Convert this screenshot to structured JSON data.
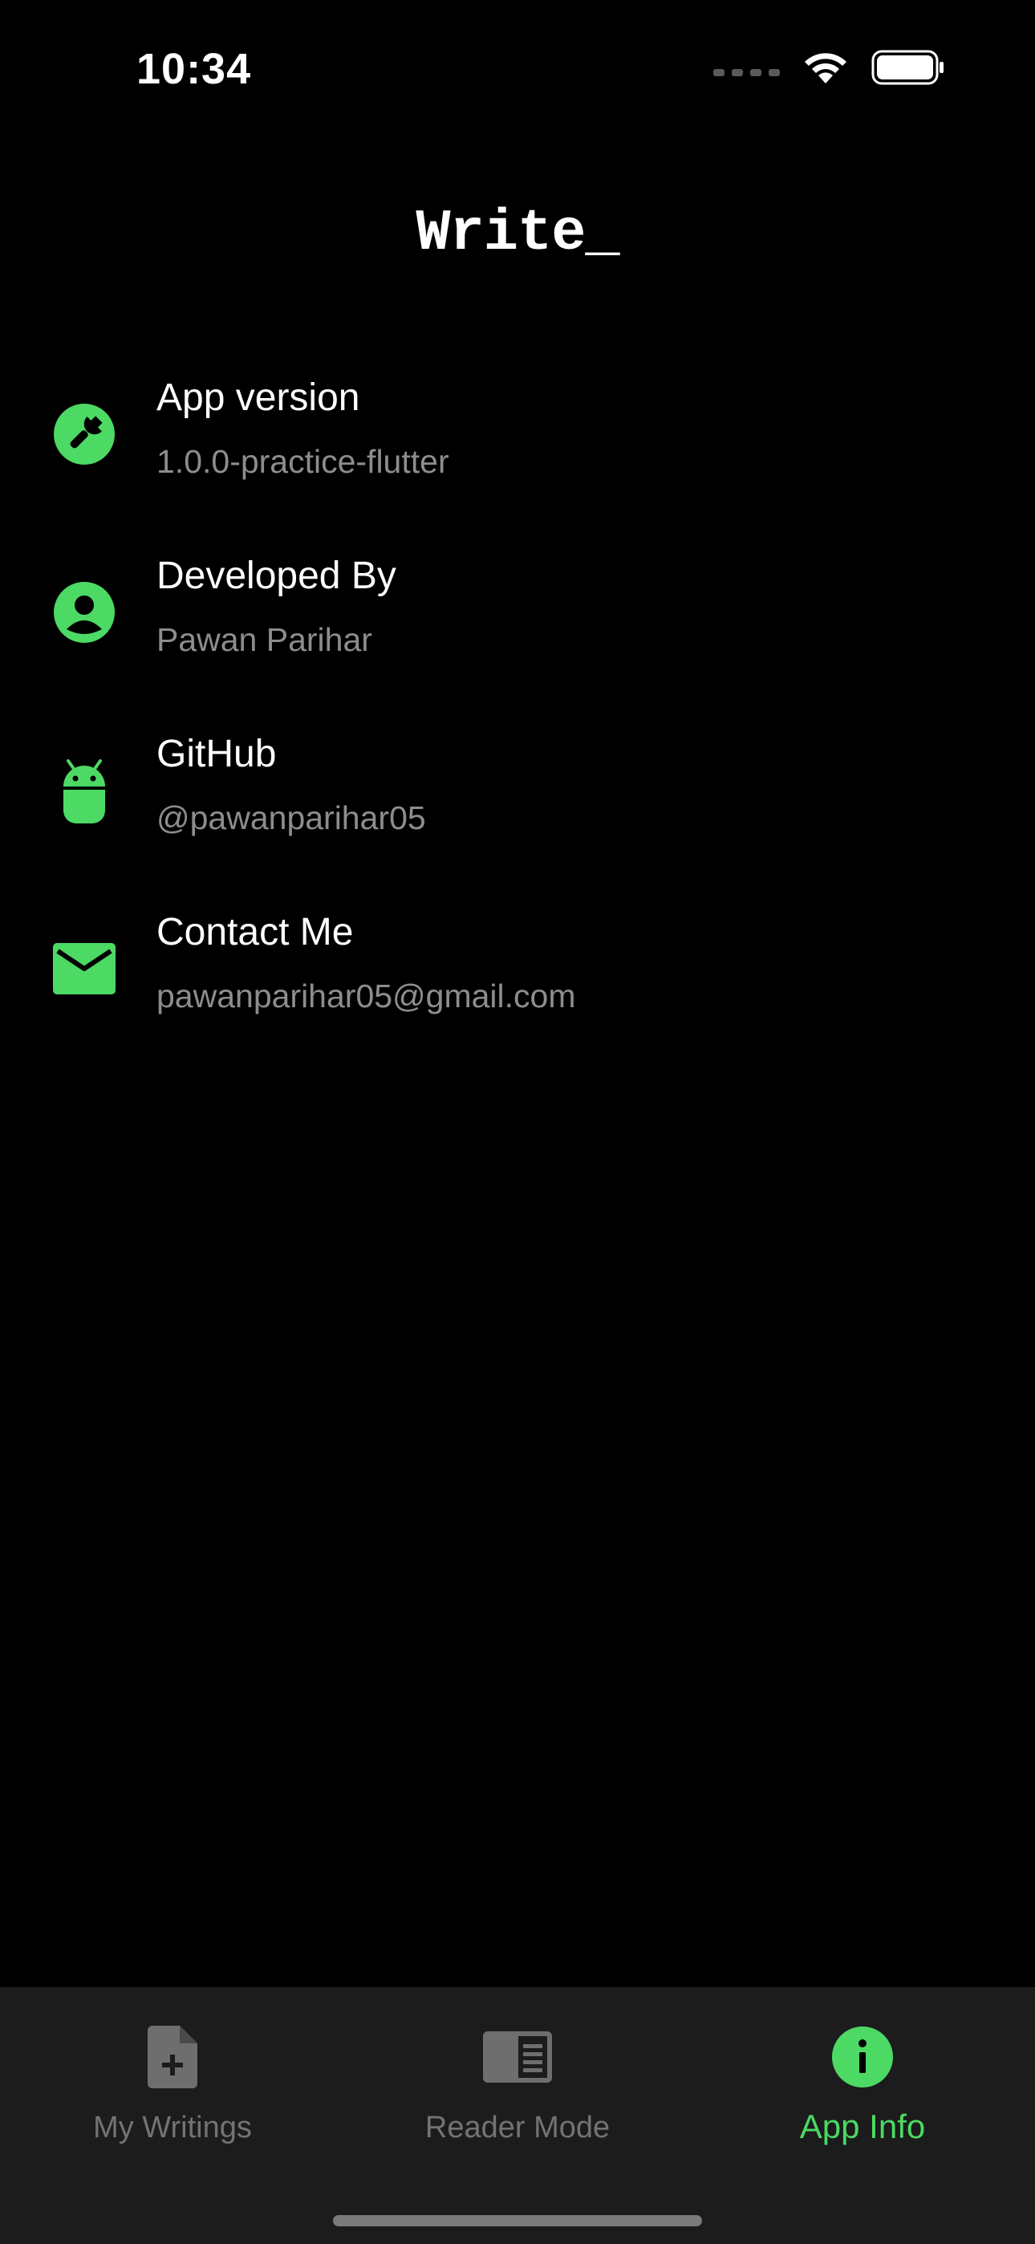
{
  "status_bar": {
    "time": "10:34"
  },
  "header": {
    "title": "Write_"
  },
  "info_items": [
    {
      "title": "App version",
      "subtitle": "1.0.0-practice-flutter",
      "icon": "wrench-icon"
    },
    {
      "title": "Developed By",
      "subtitle": "Pawan Parihar",
      "icon": "account-icon"
    },
    {
      "title": "GitHub",
      "subtitle": "@pawanparihar05",
      "icon": "android-icon"
    },
    {
      "title": "Contact Me",
      "subtitle": "pawanparihar05@gmail.com",
      "icon": "mail-icon"
    }
  ],
  "bottom_nav": {
    "items": [
      {
        "label": "My Writings",
        "icon": "note-add-icon",
        "active": false
      },
      {
        "label": "Reader Mode",
        "icon": "chrome-reader-mode-icon",
        "active": false
      },
      {
        "label": "App Info",
        "icon": "info-icon",
        "active": true
      }
    ]
  },
  "colors": {
    "accent": "#4cd964",
    "background": "#000000",
    "nav_background": "#1c1c1c",
    "muted_text": "#8d8d8d"
  }
}
